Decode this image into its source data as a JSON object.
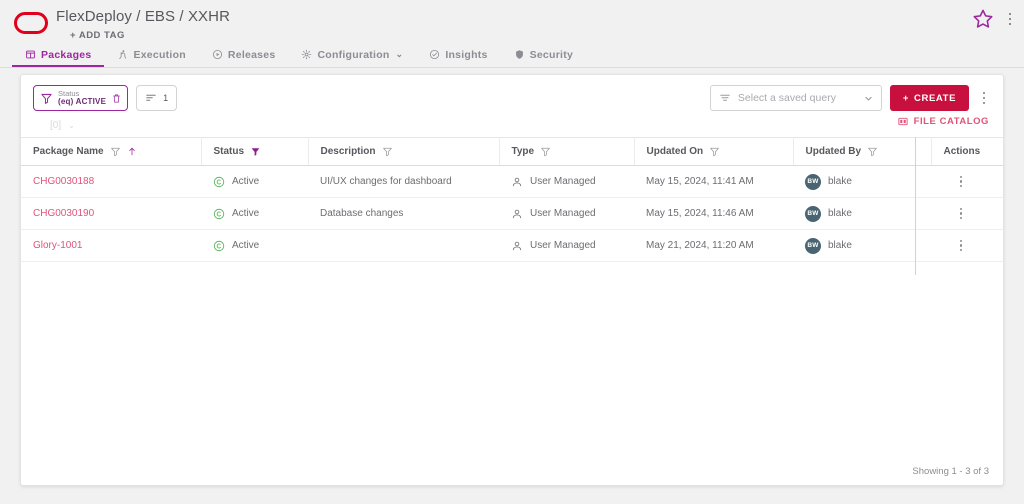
{
  "header": {
    "logo_icon": "oracle-logo-icon",
    "breadcrumb": "FlexDeploy / EBS / XXHR",
    "add_tag_label": "+ ADD TAG",
    "favorite_icon": "star-icon",
    "overflow_icon": "kebab-menu-icon"
  },
  "tabs": [
    {
      "label": "Packages",
      "icon": "package-icon",
      "active": true
    },
    {
      "label": "Execution",
      "icon": "runner-icon",
      "active": false
    },
    {
      "label": "Releases",
      "icon": "play-circle-icon",
      "active": false
    },
    {
      "label": "Configuration",
      "icon": "gear-icon",
      "active": false,
      "caret": "⌄"
    },
    {
      "label": "Insights",
      "icon": "check-circle-icon",
      "active": false
    },
    {
      "label": "Security",
      "icon": "shield-icon",
      "active": false
    }
  ],
  "toolbar": {
    "filter_chip": {
      "icon": "filter-icon",
      "label": "Status",
      "value": "(eq) ACTIVE",
      "delete_icon": "trash-icon"
    },
    "sort_chip": {
      "icon": "sort-icon",
      "count": "1"
    },
    "group_row": {
      "value": "[0]",
      "caret": "⌄"
    },
    "saved_query": {
      "icon": "filter-lines-icon",
      "placeholder": "Select a saved query",
      "value": "",
      "caret_icon": "chevron-down-icon"
    },
    "create_label": "CREATE",
    "create_plus": "+",
    "create_color": "#c8103e",
    "overflow_icon": "kebab-menu-icon",
    "file_catalog_label": "FILE CATALOG",
    "file_catalog_icon": "catalog-icon"
  },
  "table": {
    "columns": [
      {
        "label": "Package Name",
        "filter": "outline",
        "sort": "asc"
      },
      {
        "label": "Status",
        "filter": "filled",
        "sort": ""
      },
      {
        "label": "Description",
        "filter": "outline",
        "sort": ""
      },
      {
        "label": "Type",
        "filter": "outline",
        "sort": ""
      },
      {
        "label": "Updated On",
        "filter": "outline",
        "sort": ""
      },
      {
        "label": "Updated By",
        "filter": "outline",
        "sort": ""
      },
      {
        "label": "Actions",
        "filter": "",
        "sort": ""
      }
    ],
    "rows": [
      {
        "package_name": "CHG0030188",
        "status": "Active",
        "status_icon": "active-circle-icon",
        "description": "UI/UX changes for dashboard",
        "type": "User Managed",
        "type_icon": "user-icon",
        "updated_on": "May 15, 2024, 11:41 AM",
        "updated_by": "blake",
        "updated_by_initials": "BW",
        "actions_icon": "kebab-menu-icon"
      },
      {
        "package_name": "CHG0030190",
        "status": "Active",
        "status_icon": "active-circle-icon",
        "description": "Database changes",
        "type": "User Managed",
        "type_icon": "user-icon",
        "updated_on": "May 15, 2024, 11:46 AM",
        "updated_by": "blake",
        "updated_by_initials": "BW",
        "actions_icon": "kebab-menu-icon"
      },
      {
        "package_name": "Glory-1001",
        "status": "Active",
        "status_icon": "active-circle-icon",
        "description": "",
        "type": "User Managed",
        "type_icon": "user-icon",
        "updated_on": "May 21, 2024, 11:20 AM",
        "updated_by": "blake",
        "updated_by_initials": "BW",
        "actions_icon": "kebab-menu-icon"
      }
    ],
    "footer": "Showing 1 - 3 of 3"
  },
  "colors": {
    "accent_purple": "#9c27a0",
    "accent_crimson": "#c8103e",
    "link_pink": "#e0537a",
    "status_green": "#5cb85c",
    "avatar_bg": "#4a6572",
    "logo_red": "#e0001b"
  }
}
